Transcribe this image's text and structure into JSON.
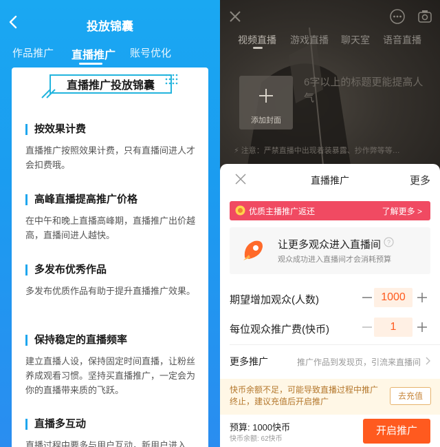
{
  "left": {
    "header": {
      "title": "投放锦囊"
    },
    "tabs": [
      {
        "label": "作品推广"
      },
      {
        "label": "直播推广"
      },
      {
        "label": "账号优化"
      }
    ],
    "banner": "直播推广投放锦囊",
    "sections": [
      {
        "title": "按效果计费",
        "text": "直播推广按照效果计费，只有直播间进人才会扣费哦。"
      },
      {
        "title": "高峰直播提高推广价格",
        "text": "在中午和晚上直播高峰期，直播推广出价越高，直播间进人越快。"
      },
      {
        "title": "多发布优秀作品",
        "text": "多发布优质作品有助于提升直播推广效果。"
      },
      {
        "title": "保持稳定的直播频率",
        "text": "建立直播人设，保持固定时间直播，让粉丝养成观看习惯。坚持买直播推广，一定会为你的直播带来质的飞跃。"
      },
      {
        "title": "直播多互动",
        "text": "直播过程中要多与用户互动，新用户进入"
      }
    ]
  },
  "right": {
    "live_tabs": [
      {
        "label": "视频直播"
      },
      {
        "label": "游戏直播"
      },
      {
        "label": "聊天室"
      },
      {
        "label": "语音直播"
      }
    ],
    "cover_label": "添加封面",
    "title_placeholder": "6字以上的标题更能提高人气",
    "notice": "注意：严禁直播中出现着装暴露、抄作弊等等…",
    "sheet": {
      "title": "直播推广",
      "more": "更多",
      "promo_text": "优质主播推广返还",
      "promo_link": "了解更多 >",
      "info_title": "让更多观众进入直播间",
      "info_sub": "观众成功进入直播间才会消耗预算",
      "row1": {
        "label": "期望增加观众(人数)",
        "value": "1000"
      },
      "row2": {
        "label": "每位观众推广费(快币)",
        "value": "1"
      },
      "more_promo_label": "更多推广",
      "more_promo_desc": "推广作品到发现页，引流来直播间",
      "warning": "快币余额不足，可能导致直播过程中推广终止，建议充值后开启推广",
      "recharge": "去充值",
      "budget": "预算: 1000快币",
      "balance": "快币余额: 62快币",
      "start": "开启推广"
    }
  },
  "colors": {
    "left_bg": "#1b9cf0",
    "accent_blue": "#1ea6ee",
    "promo_red": "#f04a62",
    "accent_orange": "#ff5a1f",
    "warn_bg": "#fff7e6"
  },
  "icons": [
    "back-arrow-icon",
    "close-icon",
    "more-dots-icon",
    "camera-icon",
    "plus-icon",
    "warning-icon",
    "medal-icon",
    "rocket-icon",
    "help-icon",
    "minus-icon",
    "chevron-right-icon"
  ]
}
